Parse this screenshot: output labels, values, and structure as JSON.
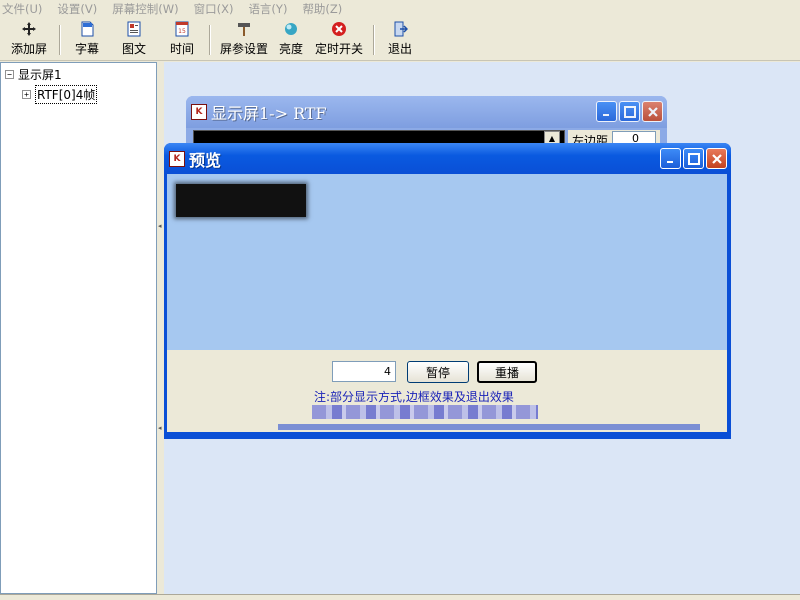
{
  "menu": [
    "文件(U)",
    "设置(V)",
    "屏幕控制(W)",
    "窗口(X)",
    "语言(Y)",
    "帮助(Z)"
  ],
  "toolbar": {
    "buttons": [
      {
        "label": "添加屏",
        "icon": "add-screen-icon"
      },
      {
        "label": "字幕",
        "icon": "caption-icon"
      },
      {
        "label": "图文",
        "icon": "image-text-icon"
      },
      {
        "label": "时间",
        "icon": "calendar-icon"
      },
      {
        "label": "屏参设置",
        "icon": "hammer-icon"
      },
      {
        "label": "亮度",
        "icon": "brightness-icon"
      },
      {
        "label": "定时开关",
        "icon": "timer-switch-icon"
      },
      {
        "label": "退出",
        "icon": "exit-icon"
      }
    ]
  },
  "tree": {
    "root": {
      "label": "显示屏1",
      "expander": "⊟"
    },
    "child": {
      "label": "RTF[0]4帧",
      "expander": "+"
    }
  },
  "back_window": {
    "title": "显示屏1-> RTF",
    "margin_label": "左边距",
    "margin_value": "0"
  },
  "preview_window": {
    "title": "预览",
    "frame_value": "4",
    "pause_label": "暂停",
    "replay_label": "重播",
    "note": "注:部分显示方式,边框效果及退出效果"
  },
  "colors": {
    "xp_title_blue": "#0a5ae0",
    "mdi_background": "#dbe6f6",
    "preview_canvas": "#a6c8f0",
    "note_text": "#1a23b8"
  }
}
